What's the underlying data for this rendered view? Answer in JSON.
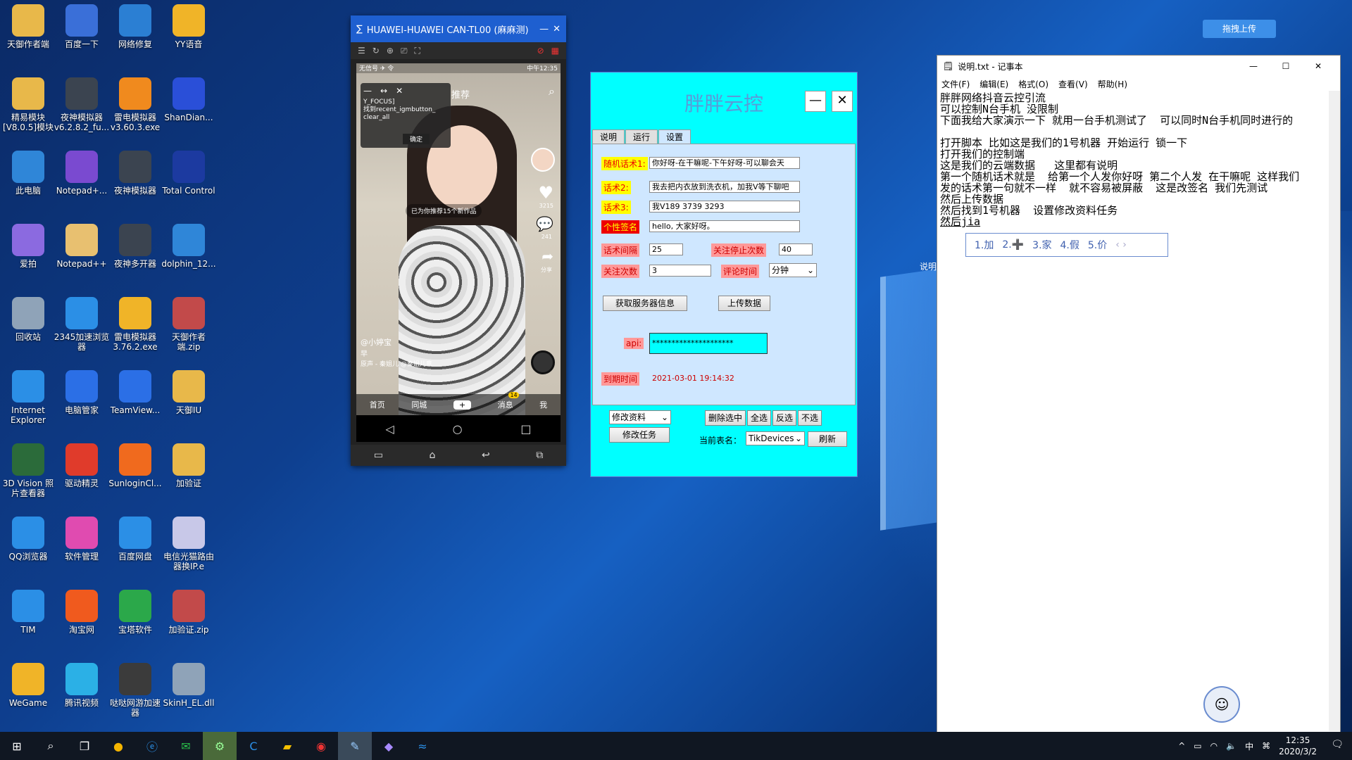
{
  "desktop_icons": [
    {
      "label": "天御作者端",
      "color": "#e8b84a"
    },
    {
      "label": "百度一下",
      "color": "#3a6fd8"
    },
    {
      "label": "网络修复",
      "color": "#2b7fd3"
    },
    {
      "label": "YY语音",
      "color": "#f0b428"
    },
    {
      "label": "精易模块[V8.0.5]模块",
      "color": "#e8b84a"
    },
    {
      "label": "夜神模拟器 v6.2.8.2_fu...",
      "color": "#3b4450"
    },
    {
      "label": "雷电模拟器 v3.60.3.exe",
      "color": "#f08a1e"
    },
    {
      "label": "ShanDian...",
      "color": "#2a4fd8"
    },
    {
      "label": "此电脑",
      "color": "#2f86d8"
    },
    {
      "label": "Notepad+...",
      "color": "#7a4ad0"
    },
    {
      "label": "夜神模拟器",
      "color": "#3b4450"
    },
    {
      "label": "Total Control",
      "color": "#1c3aa0"
    },
    {
      "label": "爱拍",
      "color": "#8b6ae0"
    },
    {
      "label": "Notepad++",
      "color": "#e8c070"
    },
    {
      "label": "夜神多开器",
      "color": "#3b4450"
    },
    {
      "label": "dolphin_12...",
      "color": "#2f86d8"
    },
    {
      "label": "回收站",
      "color": "#8fa3b8"
    },
    {
      "label": "2345加速浏览器",
      "color": "#2b8fe6"
    },
    {
      "label": "雷电模拟器 3.76.2.exe",
      "color": "#f0b428"
    },
    {
      "label": "天御作者端.zip",
      "color": "#c24a4a"
    },
    {
      "label": "Internet Explorer",
      "color": "#2b8fe6"
    },
    {
      "label": "电脑管家",
      "color": "#2b6fe6"
    },
    {
      "label": "TeamView...",
      "color": "#2b6fe6"
    },
    {
      "label": "天御IU",
      "color": "#e8b84a"
    },
    {
      "label": "3D Vision 照片查看器",
      "color": "#2b6b3a"
    },
    {
      "label": "驱动精灵",
      "color": "#e03b2b"
    },
    {
      "label": "SunloginCl...",
      "color": "#f06a1e"
    },
    {
      "label": "加验证",
      "color": "#e8b84a"
    },
    {
      "label": "QQ浏览器",
      "color": "#2b8fe6"
    },
    {
      "label": "软件管理",
      "color": "#e04bb0"
    },
    {
      "label": "百度网盘",
      "color": "#2b8fe6"
    },
    {
      "label": "电信光猫路由器换IP.e",
      "color": "#c8c8e8"
    },
    {
      "label": "TIM",
      "color": "#2b8fe6"
    },
    {
      "label": "淘宝网",
      "color": "#f05a1e"
    },
    {
      "label": "宝塔软件",
      "color": "#2ba84a"
    },
    {
      "label": "加验证.zip",
      "color": "#c24a4a"
    },
    {
      "label": "WeGame",
      "color": "#f0b428"
    },
    {
      "label": "腾讯视频",
      "color": "#2bb0e6"
    },
    {
      "label": "哒哒网游加速器",
      "color": "#3b3b3b"
    },
    {
      "label": "SkinH_EL.dll",
      "color": "#8fa3b8"
    }
  ],
  "phone": {
    "title": "HUAWEI-HUAWEI CAN-TL00 (麻麻测)",
    "status_left": "无信号 ✈ 令",
    "status_right": "中午12:35",
    "dialog_text": "Y_FOCUS]\n找到recent_igmbutton_\nclear_all",
    "dialog_confirm": "确定",
    "tab_recommend": "推荐",
    "like_count": "3215",
    "comment_count": "241",
    "share_label": "分享",
    "recommend_bubble": "已为你推荐15个新作品",
    "username": "@小婷宝",
    "caption": "早",
    "music": "原声 - 秦姐儿  @秦姐儿意",
    "bottom_nav": [
      "首页",
      "同城",
      "+",
      "消息",
      "我"
    ],
    "msg_badge": "14"
  },
  "app": {
    "title": "胖胖云控",
    "tabs": [
      "说明",
      "运行",
      "设置"
    ],
    "script1_label": "随机话术1:",
    "script1_value": "你好呀-在干嘛呢-下午好呀-可以聊会天",
    "script2_label": "话术2:",
    "script2_value": "我去把内衣放到洗衣机，加我V等下聊吧",
    "script3_label": "话术3:",
    "script3_value": "我V189 3739 3293",
    "signature_label": "个性签名",
    "signature_value": "hello, 大家好呀。",
    "interval_label": "话术间隔",
    "interval_value": "25",
    "follow_stop_label": "关注停止次数",
    "follow_stop_value": "40",
    "follow_count_label": "关注次数",
    "follow_count_value": "3",
    "comment_time_label": "评论时间",
    "comment_time_value": "分钟",
    "get_server_btn": "获取服务器信息",
    "upload_btn": "上传数据",
    "api_label": "api:",
    "api_value": "*********************",
    "expire_label": "到期时间",
    "expire_value": "2021-03-01 19:14:32",
    "action_select": "修改资料",
    "modify_task_btn": "修改任务",
    "delete_selected": "删除选中",
    "select_all": "全选",
    "invert": "反选",
    "select_none": "不选",
    "current_table_label": "当前表名：",
    "current_table_value": "TikDevices",
    "refresh_btn": "刷新"
  },
  "notepad": {
    "title": "说明.txt - 记事本",
    "menu": [
      "文件(F)",
      "编辑(E)",
      "格式(O)",
      "查看(V)",
      "帮助(H)"
    ],
    "lines": [
      "胖胖网络抖音云控引流",
      "可以控制N台手机 没限制",
      "下面我给大家演示一下 就用一台手机测试了  可以同时N台手机同时进行的",
      "",
      "打开脚本 比如这是我们的1号机器 开始运行 锁一下",
      "打开我们的控制端",
      "这是我们的云端数据   这里都有说明",
      "第一个随机话术就是  给第一个人发你好呀 第二个人发 在干嘛呢 这样我们",
      "发的话术第一句就不一样  就不容易被屏蔽  这是改签名 我们先测试",
      "然后上传数据",
      "然后找到1号机器  设置修改资料任务",
      "然后jia"
    ],
    "ime_candidates": [
      "1.加",
      "2.➕",
      "3.家",
      "4.假",
      "5.价"
    ]
  },
  "upload_widget": "拖拽上传",
  "desktop_side_label": "说明",
  "taskbar": {
    "time": "12:35",
    "date": "2020/3/2",
    "ime_mode": "中"
  }
}
